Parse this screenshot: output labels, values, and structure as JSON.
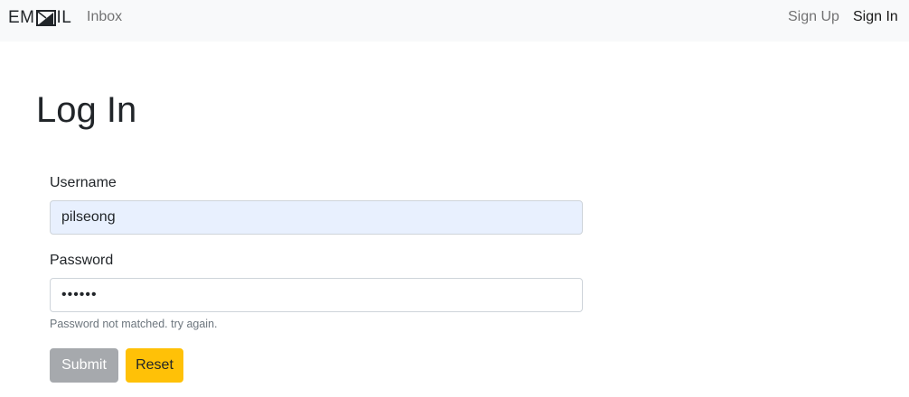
{
  "navbar": {
    "brand_prefix": "EM",
    "brand_suffix": "IL",
    "links": {
      "inbox": "Inbox",
      "sign_up": "Sign Up",
      "sign_in": "Sign In"
    }
  },
  "page": {
    "title": "Log In"
  },
  "form": {
    "username": {
      "label": "Username",
      "value": "pilseong"
    },
    "password": {
      "label": "Password",
      "value": "••••••",
      "error": "Password not matched. try again."
    },
    "submit_label": "Submit",
    "reset_label": "Reset"
  },
  "colors": {
    "navbar_bg": "#f8f9fa",
    "autofill_bg": "#e8f0fe",
    "submit_bg": "#a6a9ad",
    "reset_bg": "#ffc107"
  },
  "icons": {
    "brand_logo": "envelope-a-glyph"
  }
}
